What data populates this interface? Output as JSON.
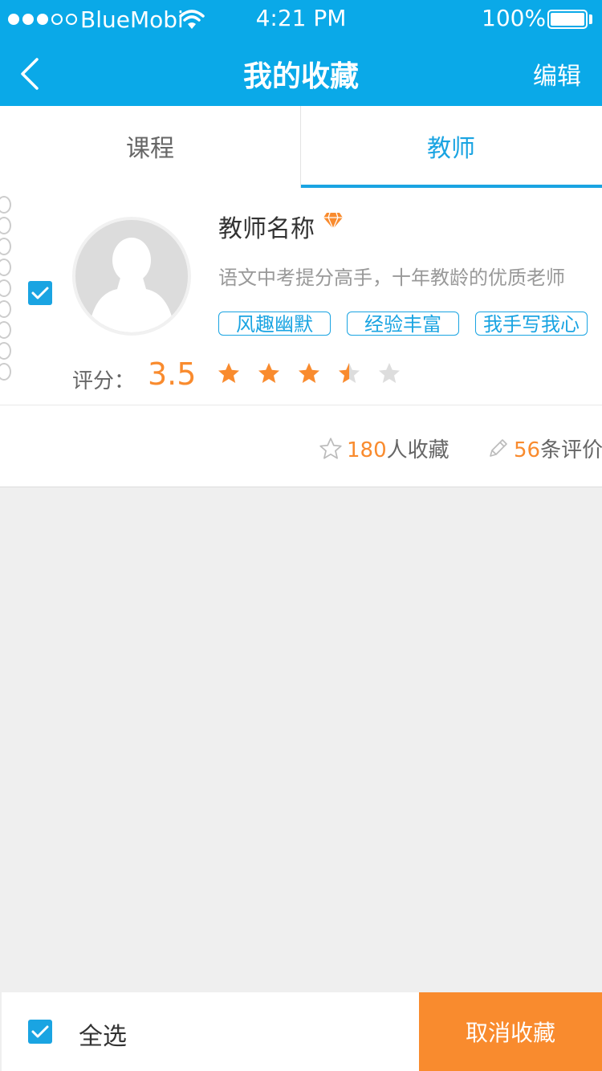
{
  "status_bar": {
    "carrier": "BlueMobi",
    "time": "4:21 PM",
    "battery": "100%"
  },
  "nav": {
    "title": "我的收藏",
    "edit_label": "编辑"
  },
  "tabs": [
    {
      "label": "课程",
      "active": false
    },
    {
      "label": "教师",
      "active": true
    }
  ],
  "teacher_card": {
    "selected": true,
    "name": "教师名称",
    "description": "语文中考提分高手，十年教龄的优质老师",
    "tags": [
      "风趣幽默",
      "经验丰富",
      "我手写我心"
    ],
    "rating_label": "评分：",
    "rating": "3.5",
    "stars_filled": 3.5,
    "stars_total": 5,
    "favorites_count": "180",
    "favorites_suffix": "人收藏",
    "reviews_count": "56",
    "reviews_suffix": "条评价"
  },
  "bottom_bar": {
    "select_all_label": "全选",
    "select_all_checked": true,
    "cancel_label": "取消收藏"
  },
  "colors": {
    "primary": "#0aa9e8",
    "accent": "#1aa4e2",
    "orange": "#f98b2e",
    "background": "#efefef"
  }
}
